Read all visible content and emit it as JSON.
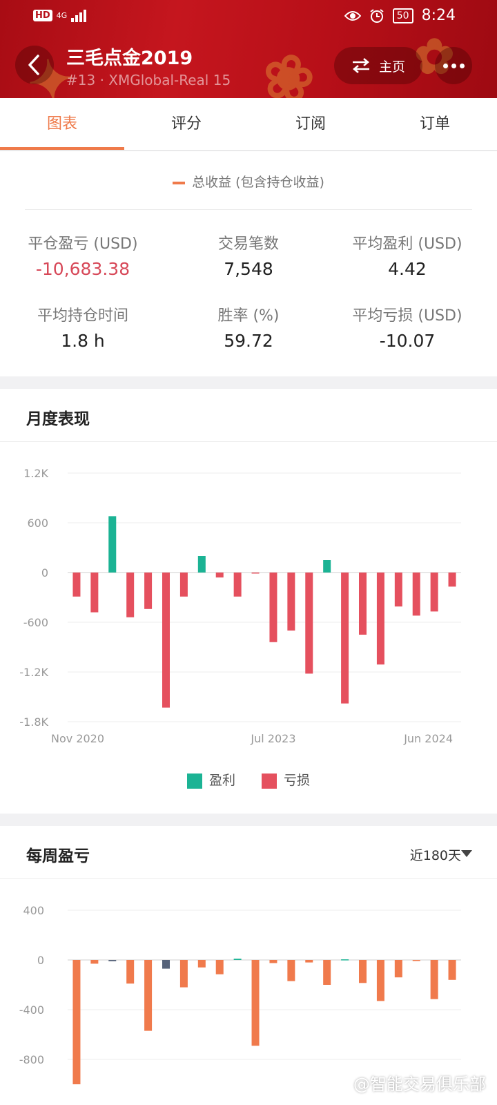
{
  "status_bar": {
    "network": "4G",
    "battery": "50",
    "time": "8:24"
  },
  "header": {
    "title": "三毛点金2019",
    "subtitle": "#13 · XMGlobal-Real 15",
    "home_label": "主页"
  },
  "tabs": [
    {
      "label": "图表",
      "active": true
    },
    {
      "label": "评分",
      "active": false
    },
    {
      "label": "订阅",
      "active": false
    },
    {
      "label": "订单",
      "active": false
    }
  ],
  "summary": {
    "legend": "总收益 (包含持仓收益)",
    "stats": [
      {
        "label": "平仓盈亏 (USD)",
        "value": "-10,683.38"
      },
      {
        "label": "交易笔数",
        "value": "7,548"
      },
      {
        "label": "平均盈利 (USD)",
        "value": "4.42"
      },
      {
        "label": "平均持仓时间",
        "value": "1.8 h"
      },
      {
        "label": "胜率 (%)",
        "value": "59.72"
      },
      {
        "label": "平均亏损 (USD)",
        "value": "-10.07"
      }
    ]
  },
  "monthly": {
    "title": "月度表现",
    "legend": [
      {
        "label": "盈利",
        "color": "#1bb394"
      },
      {
        "label": "亏损",
        "color": "#e5505e"
      }
    ]
  },
  "weekly": {
    "title": "每周盈亏",
    "range_label": "近180天"
  },
  "watermark": "@智能交易俱乐部",
  "chart_data": [
    {
      "type": "bar",
      "ylim": [
        -1800,
        1200
      ],
      "y_ticks": [
        "1.2K",
        "600",
        "0",
        "-600",
        "-1.2K",
        "-1.8K"
      ],
      "x_tick_labels": [
        "Nov 2020",
        "Jul 2023",
        "Jun 2024"
      ],
      "series": [
        {
          "name": "盈利",
          "color": "#1bb394"
        },
        {
          "name": "亏损",
          "color": "#e5505e"
        }
      ],
      "values": [
        -290,
        -480,
        680,
        -540,
        -440,
        -1630,
        -290,
        200,
        -60,
        -290,
        -10,
        -840,
        -700,
        -1220,
        150,
        -1580,
        -750,
        -1110,
        -410,
        -520,
        -470,
        -170
      ]
    },
    {
      "type": "bar",
      "ylim": [
        -1000,
        400
      ],
      "y_ticks": [
        "400",
        "0",
        "-400",
        "-800"
      ],
      "colors": {
        "negative": "#f07a4c",
        "positive": "#1bb394",
        "neutral": "#56637a"
      },
      "values": [
        -1000,
        -30,
        -10,
        -190,
        -570,
        -70,
        -220,
        -60,
        -115,
        10,
        -690,
        -25,
        -170,
        -20,
        -200,
        5,
        -185,
        -330,
        -140,
        -5,
        -315,
        -160
      ],
      "neutral_indices": [
        2,
        5
      ]
    }
  ]
}
